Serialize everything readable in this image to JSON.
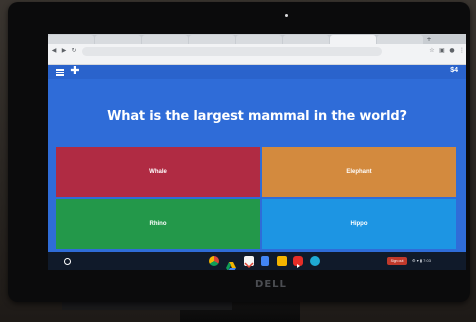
{
  "browser": {
    "tabs": [
      "",
      "",
      "",
      "",
      "",
      "",
      "",
      "",
      ""
    ],
    "new_tab_glyph": "+",
    "omnibox_text": ""
  },
  "page": {
    "score": "$4",
    "question": "What is the largest mammal in the world?",
    "answers": [
      {
        "label": "Whale",
        "color": "#b02b43"
      },
      {
        "label": "Elephant",
        "color": "#d38a3e"
      },
      {
        "label": "Rhino",
        "color": "#23984a"
      },
      {
        "label": "Hippo",
        "color": "#1d95e3"
      }
    ]
  },
  "shelf": {
    "apps": [
      "chrome-icon",
      "drive-icon",
      "gmail-icon",
      "docs-icon",
      "slides-icon",
      "youtube-icon",
      "meet-icon"
    ],
    "signout_label": "Sign out",
    "tray_text": "⚙ ▾ ▮ 7:03"
  },
  "monitor": {
    "brand": "DELL"
  }
}
